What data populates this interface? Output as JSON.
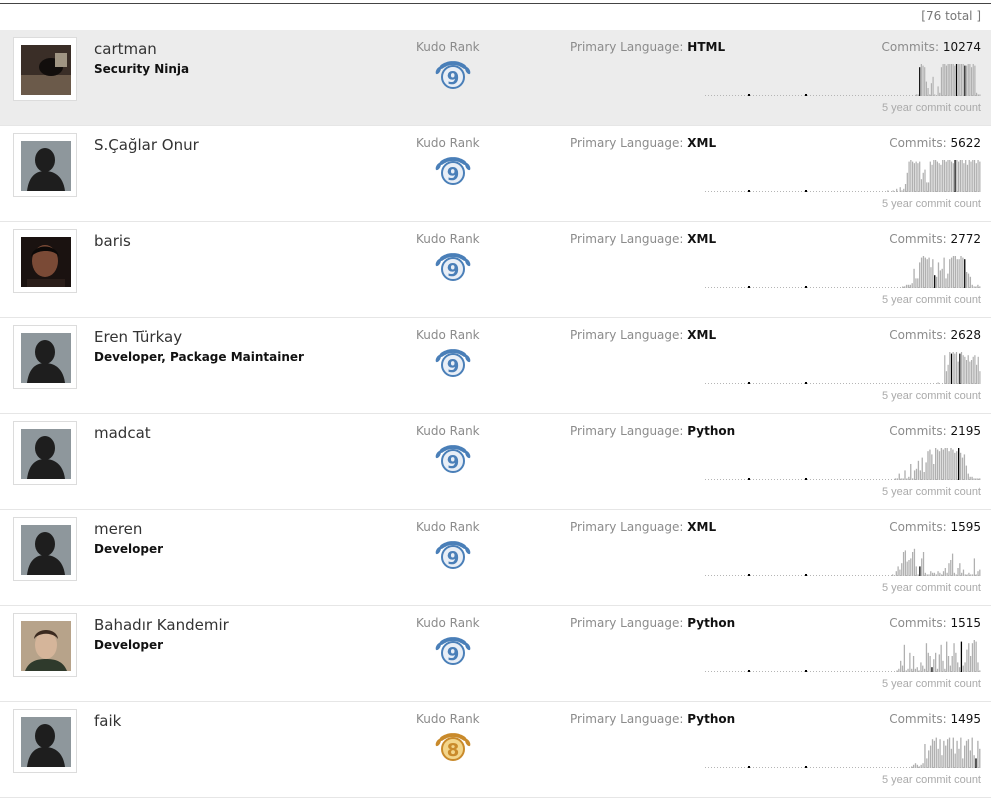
{
  "header": {
    "total": "[76 total ]"
  },
  "labels": {
    "kudo": "Kudo Rank",
    "primary_language": "Primary Language:",
    "commits": "Commits:",
    "chart_caption": "5 year commit count"
  },
  "colors": {
    "selected_row_bg": "#ececec",
    "bar": "#b0b0b0",
    "bar_dark": "#000000",
    "kudo_silver": "#4a7fb8",
    "kudo_gold": "#c98a2b"
  },
  "people": [
    {
      "name": "cartman",
      "role": "Security Ninja",
      "avatar": "photo-dark",
      "kudo_rank": "9",
      "kudo_tier": "silver",
      "language": "HTML",
      "commits": "10274",
      "selected": true,
      "bars": [
        0,
        0,
        0,
        0,
        0,
        0,
        0,
        0,
        0,
        0,
        0,
        0,
        0,
        0,
        0,
        0,
        0,
        0,
        0,
        0,
        0,
        0,
        0,
        0,
        0,
        0,
        0,
        0,
        0,
        0,
        0,
        0,
        0,
        0,
        0,
        0,
        0,
        0,
        0,
        0,
        0,
        0,
        0,
        0,
        0,
        0,
        0,
        0,
        0,
        0,
        0,
        0,
        0,
        0,
        0,
        0,
        0,
        0,
        0,
        0,
        0,
        0,
        0,
        0,
        0,
        0,
        0,
        0,
        0,
        0,
        0,
        0,
        0,
        0,
        0,
        0,
        0,
        0,
        0,
        0,
        0,
        0,
        0,
        0,
        0,
        0,
        0,
        0,
        0,
        0,
        0,
        0,
        0,
        0,
        0,
        0,
        0,
        0,
        0,
        0,
        0,
        0,
        0,
        0,
        0,
        0,
        0,
        0,
        0,
        0,
        0,
        0,
        0,
        0,
        0,
        0,
        0,
        0,
        0,
        0,
        0,
        0,
        0,
        0,
        0,
        0,
        0.05,
        0.05,
        0.9,
        1,
        0.95,
        0.9,
        0.45,
        0.25,
        0.05,
        0.4,
        0.6,
        0.05,
        0,
        0.3,
        0.1,
        0.9,
        1,
        1,
        0.95,
        1,
        1,
        1,
        1,
        0.95,
        1,
        1,
        1,
        1,
        1,
        0.95,
        0.95,
        1,
        1,
        0.9,
        1,
        0.95,
        0.1,
        0.05,
        0.05
      ],
      "dark": [
        128,
        150,
        155,
        165
      ]
    },
    {
      "name": "S.Çağlar Onur",
      "role": "",
      "avatar": "silhouette",
      "kudo_rank": "9",
      "kudo_tier": "silver",
      "language": "XML",
      "commits": "5622",
      "selected": false,
      "bars": [
        0,
        0,
        0,
        0,
        0,
        0,
        0,
        0,
        0,
        0,
        0,
        0,
        0,
        0,
        0,
        0,
        0,
        0,
        0,
        0,
        0,
        0,
        0,
        0,
        0,
        0,
        0,
        0,
        0,
        0,
        0,
        0,
        0,
        0,
        0,
        0,
        0,
        0,
        0,
        0,
        0,
        0,
        0,
        0,
        0,
        0,
        0,
        0,
        0,
        0,
        0,
        0,
        0,
        0,
        0,
        0,
        0,
        0,
        0,
        0,
        0,
        0,
        0,
        0,
        0,
        0,
        0,
        0,
        0,
        0,
        0,
        0,
        0,
        0,
        0,
        0,
        0,
        0,
        0,
        0,
        0,
        0,
        0,
        0,
        0,
        0,
        0,
        0,
        0,
        0,
        0,
        0,
        0,
        0,
        0,
        0,
        0,
        0,
        0,
        0,
        0,
        0,
        0,
        0.05,
        0,
        0,
        0.05,
        0,
        0.1,
        0,
        0.15,
        0.05,
        0.1,
        0.25,
        0.6,
        0.95,
        1,
        0.95,
        0.9,
        0.95,
        0.9,
        0.95,
        0.4,
        0.6,
        0.7,
        0.3,
        0.3,
        0.95,
        0.85,
        1,
        1,
        0.95,
        0.9,
        0.85,
        1,
        1,
        0.95,
        1,
        1,
        0.95,
        0.9,
        1,
        1,
        0.95,
        1,
        1,
        0.9,
        1,
        0.85,
        1,
        0.95,
        1,
        1,
        0.9,
        1,
        0.95
      ],
      "dark": [
        141,
        160,
        167
      ]
    },
    {
      "name": "baris",
      "role": "",
      "avatar": "photo-face",
      "kudo_rank": "9",
      "kudo_tier": "silver",
      "language": "XML",
      "commits": "2772",
      "selected": false,
      "bars": [
        0,
        0,
        0,
        0,
        0,
        0,
        0,
        0,
        0,
        0,
        0,
        0,
        0,
        0,
        0,
        0,
        0,
        0,
        0,
        0,
        0,
        0,
        0,
        0,
        0,
        0,
        0,
        0,
        0,
        0,
        0,
        0,
        0,
        0,
        0,
        0,
        0,
        0,
        0,
        0,
        0,
        0,
        0,
        0,
        0,
        0,
        0,
        0,
        0,
        0,
        0,
        0,
        0,
        0,
        0,
        0,
        0,
        0,
        0,
        0,
        0,
        0,
        0,
        0,
        0,
        0,
        0,
        0,
        0,
        0,
        0,
        0,
        0,
        0,
        0,
        0,
        0,
        0,
        0,
        0,
        0,
        0,
        0,
        0,
        0,
        0,
        0,
        0,
        0,
        0,
        0,
        0,
        0,
        0,
        0,
        0,
        0,
        0,
        0,
        0,
        0,
        0,
        0,
        0,
        0,
        0.05,
        0.05,
        0.1,
        0.1,
        0.1,
        0.15,
        0.6,
        0.3,
        0.3,
        0.8,
        0.95,
        1,
        0.95,
        0.9,
        0.95,
        0.65,
        0.9,
        0.4,
        0.35,
        0.8,
        0.55,
        0.6,
        0.95,
        0.3,
        0.45,
        0.9,
        0.95,
        1,
        1,
        0.9,
        0.9,
        1,
        0.95,
        0.9,
        0.5,
        0.45,
        0.35,
        0.1,
        0.05,
        0.05,
        0.1,
        0.05
      ],
      "dark": [
        122,
        138,
        150
      ]
    },
    {
      "name": "Eren Türkay",
      "role": "Developer, Package Maintainer",
      "avatar": "silhouette",
      "kudo_rank": "9",
      "kudo_tier": "silver",
      "language": "XML",
      "commits": "2628",
      "selected": false,
      "bars": [
        0,
        0,
        0,
        0,
        0,
        0,
        0,
        0,
        0,
        0,
        0,
        0,
        0,
        0,
        0,
        0,
        0,
        0,
        0,
        0,
        0,
        0,
        0,
        0,
        0,
        0,
        0,
        0,
        0,
        0,
        0,
        0,
        0,
        0,
        0,
        0,
        0,
        0,
        0,
        0,
        0,
        0,
        0,
        0,
        0,
        0,
        0,
        0,
        0,
        0,
        0,
        0,
        0,
        0,
        0,
        0,
        0,
        0,
        0,
        0,
        0,
        0,
        0,
        0,
        0,
        0,
        0,
        0,
        0,
        0,
        0,
        0,
        0,
        0,
        0,
        0,
        0,
        0,
        0,
        0,
        0,
        0,
        0,
        0,
        0,
        0,
        0,
        0,
        0,
        0,
        0,
        0,
        0,
        0,
        0,
        0,
        0,
        0,
        0,
        0,
        0,
        0,
        0,
        0,
        0,
        0,
        0,
        0,
        0,
        0,
        0,
        0,
        0,
        0,
        0,
        0,
        0,
        0,
        0,
        0,
        0,
        0,
        0,
        0,
        0,
        0,
        0,
        0,
        0,
        0,
        0,
        0,
        0,
        0,
        0,
        0,
        0,
        0,
        0,
        0.05,
        0,
        0,
        0,
        0.9,
        0.4,
        0.6,
        1,
        0.95,
        1,
        0.95,
        1,
        0.7,
        0.95,
        1,
        0.9,
        0.85,
        0.75,
        0.9,
        0.7,
        0.75,
        0.85,
        0.9,
        0.6,
        0.85,
        0.4
      ],
      "dark": [
        147,
        152,
        168
      ]
    },
    {
      "name": "madcat",
      "role": "",
      "avatar": "silhouette",
      "kudo_rank": "9",
      "kudo_tier": "silver",
      "language": "Python",
      "commits": "2195",
      "selected": false,
      "bars": [
        0,
        0,
        0,
        0,
        0,
        0,
        0,
        0,
        0,
        0,
        0,
        0,
        0,
        0,
        0,
        0,
        0,
        0,
        0,
        0,
        0,
        0,
        0,
        0,
        0,
        0,
        0,
        0,
        0,
        0,
        0,
        0,
        0,
        0,
        0,
        0,
        0,
        0,
        0,
        0,
        0,
        0,
        0,
        0,
        0,
        0,
        0,
        0,
        0,
        0,
        0,
        0,
        0,
        0,
        0,
        0,
        0,
        0,
        0,
        0,
        0,
        0,
        0,
        0,
        0,
        0,
        0,
        0,
        0,
        0,
        0,
        0,
        0,
        0,
        0,
        0,
        0,
        0,
        0,
        0,
        0,
        0,
        0,
        0,
        0,
        0,
        0,
        0,
        0,
        0,
        0,
        0,
        0,
        0,
        0,
        0,
        0,
        0,
        0,
        0.05,
        0.05,
        0.2,
        0.05,
        0.05,
        0.3,
        0.05,
        0.1,
        0.5,
        0.05,
        0.3,
        0.35,
        0.6,
        0.3,
        0.7,
        0.25,
        0.55,
        0.9,
        0.95,
        0.8,
        0.5,
        1,
        0.95,
        0.9,
        1,
        0.95,
        1,
        1,
        0.9,
        1,
        0.95,
        0.85,
        0.9,
        1,
        0.85,
        0.7,
        0.8,
        0.45,
        0.2,
        0.1,
        0.1,
        0.05,
        0.05,
        0.05,
        0.05
      ],
      "dark": [
        132
      ]
    },
    {
      "name": "meren",
      "role": "Developer",
      "avatar": "silhouette",
      "kudo_rank": "9",
      "kudo_tier": "silver",
      "language": "XML",
      "commits": "1595",
      "selected": false,
      "bars": [
        0,
        0,
        0,
        0,
        0,
        0,
        0,
        0,
        0,
        0,
        0,
        0,
        0,
        0,
        0,
        0,
        0,
        0,
        0,
        0,
        0,
        0,
        0,
        0,
        0,
        0,
        0,
        0,
        0,
        0,
        0,
        0,
        0,
        0,
        0,
        0,
        0,
        0,
        0,
        0,
        0,
        0,
        0,
        0,
        0,
        0,
        0,
        0,
        0,
        0,
        0,
        0,
        0,
        0,
        0,
        0,
        0,
        0,
        0,
        0,
        0,
        0,
        0,
        0,
        0,
        0,
        0,
        0,
        0,
        0,
        0,
        0,
        0,
        0,
        0,
        0,
        0,
        0,
        0,
        0,
        0,
        0,
        0,
        0,
        0,
        0,
        0,
        0,
        0,
        0,
        0,
        0,
        0,
        0,
        0,
        0,
        0,
        0,
        0,
        0,
        0,
        0,
        0,
        0.05,
        0,
        0.15,
        0.3,
        0.2,
        0.4,
        0.75,
        0.8,
        0.45,
        0.5,
        0.55,
        0.75,
        0.85,
        0.3,
        0.05,
        0.3,
        0.55,
        0.75,
        0.1,
        0.05,
        0.05,
        0.15,
        0.1,
        0.1,
        0.05,
        0.15,
        0.1,
        0.05,
        0.15,
        0.25,
        0.1,
        0.4,
        0.5,
        0.7,
        0.1,
        0.05,
        0.25,
        0.4,
        0.1,
        0.2,
        0.05,
        0.05,
        0.1,
        0.05,
        0.05,
        0.55,
        0.05,
        0.15,
        0.2
      ],
      "dark": [
        118,
        160
      ]
    },
    {
      "name": "Bahadır Kandemir",
      "role": "Developer",
      "avatar": "photo-face2",
      "kudo_rank": "9",
      "kudo_tier": "silver",
      "language": "Python",
      "commits": "1515",
      "selected": false,
      "bars": [
        0,
        0,
        0,
        0,
        0,
        0,
        0,
        0,
        0,
        0,
        0,
        0,
        0,
        0,
        0,
        0,
        0,
        0,
        0,
        0,
        0,
        0,
        0,
        0,
        0,
        0,
        0,
        0,
        0,
        0,
        0,
        0,
        0,
        0,
        0,
        0,
        0,
        0,
        0,
        0,
        0,
        0,
        0,
        0,
        0,
        0,
        0,
        0,
        0,
        0,
        0,
        0,
        0,
        0,
        0,
        0,
        0,
        0,
        0,
        0,
        0,
        0,
        0,
        0,
        0,
        0,
        0,
        0,
        0,
        0,
        0,
        0,
        0,
        0,
        0,
        0,
        0,
        0,
        0,
        0,
        0,
        0,
        0,
        0,
        0,
        0,
        0,
        0,
        0,
        0,
        0,
        0,
        0,
        0,
        0,
        0,
        0,
        0,
        0,
        0,
        0,
        0,
        0,
        0,
        0.05,
        0.1,
        0.35,
        0.2,
        0.85,
        0.05,
        0.1,
        0.6,
        0.1,
        0.5,
        0.1,
        0.15,
        0.05,
        0.3,
        0.2,
        0.1,
        0.9,
        0.6,
        0.5,
        0.15,
        0.4,
        0.6,
        0.1,
        0.55,
        0.85,
        0.35,
        0.1,
        0.95,
        0.5,
        0.2,
        0.5,
        0.9,
        0.6,
        0.3,
        0.15,
        0.95,
        0.2,
        0.3,
        0.7,
        0.9,
        0.5,
        0.9,
        1,
        0.95,
        0.3,
        0.05
      ],
      "dark": [
        123,
        139,
        163
      ]
    },
    {
      "name": "faik",
      "role": "",
      "avatar": "silhouette",
      "kudo_rank": "8",
      "kudo_tier": "gold",
      "language": "Python",
      "commits": "1495",
      "selected": false,
      "bars": [
        0,
        0,
        0,
        0,
        0,
        0,
        0,
        0,
        0,
        0,
        0,
        0,
        0,
        0,
        0,
        0,
        0,
        0,
        0,
        0,
        0,
        0,
        0,
        0,
        0,
        0,
        0,
        0,
        0,
        0,
        0,
        0,
        0,
        0,
        0,
        0,
        0,
        0,
        0,
        0,
        0,
        0,
        0,
        0,
        0,
        0,
        0,
        0,
        0,
        0,
        0,
        0,
        0,
        0,
        0,
        0,
        0,
        0,
        0,
        0,
        0,
        0,
        0,
        0,
        0,
        0,
        0,
        0,
        0,
        0,
        0,
        0,
        0,
        0,
        0,
        0,
        0,
        0,
        0,
        0,
        0,
        0,
        0,
        0,
        0,
        0,
        0,
        0,
        0,
        0,
        0,
        0,
        0,
        0,
        0,
        0,
        0,
        0,
        0,
        0,
        0,
        0,
        0,
        0,
        0,
        0,
        0,
        0,
        0,
        0.05,
        0.1,
        0.15,
        0.1,
        0.05,
        0.1,
        0.15,
        0.75,
        0.3,
        0.55,
        0.7,
        0.9,
        0.85,
        0.95,
        0.6,
        0.9,
        0.4,
        0.85,
        0.7,
        0.9,
        0.95,
        0.6,
        0.95,
        0.45,
        0.85,
        0.6,
        0.95,
        0.3,
        0.7,
        0.85,
        0.9,
        0.55,
        0.95,
        0.4,
        0.3,
        0.85,
        0.6
      ],
      "dark": [
        143,
        160
      ]
    }
  ]
}
